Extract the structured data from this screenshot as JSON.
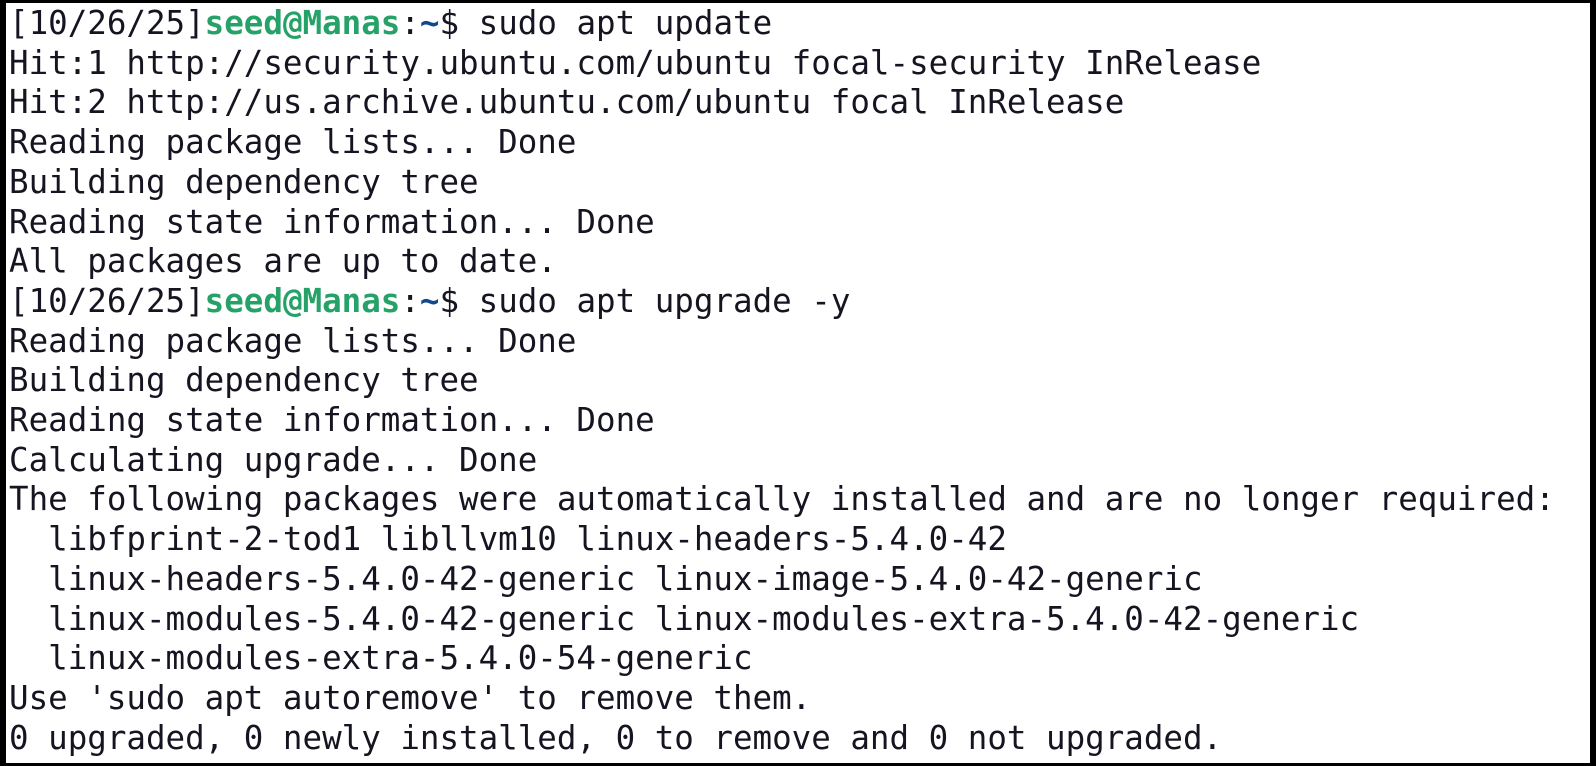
{
  "terminal": {
    "lines": [
      {
        "type": "prompt",
        "date": "[10/26/25]",
        "user": "seed@Manas",
        "sep": ":",
        "cwd": "~",
        "sym": "$ ",
        "cmd": "sudo apt update"
      },
      {
        "type": "output",
        "text": "Hit:1 http://security.ubuntu.com/ubuntu focal-security InRelease"
      },
      {
        "type": "output",
        "text": "Hit:2 http://us.archive.ubuntu.com/ubuntu focal InRelease"
      },
      {
        "type": "output",
        "text": "Reading package lists... Done"
      },
      {
        "type": "output",
        "text": "Building dependency tree"
      },
      {
        "type": "output",
        "text": "Reading state information... Done"
      },
      {
        "type": "output",
        "text": "All packages are up to date."
      },
      {
        "type": "prompt",
        "date": "[10/26/25]",
        "user": "seed@Manas",
        "sep": ":",
        "cwd": "~",
        "sym": "$ ",
        "cmd": "sudo apt upgrade -y"
      },
      {
        "type": "output",
        "text": "Reading package lists... Done"
      },
      {
        "type": "output",
        "text": "Building dependency tree"
      },
      {
        "type": "output",
        "text": "Reading state information... Done"
      },
      {
        "type": "output",
        "text": "Calculating upgrade... Done"
      },
      {
        "type": "output",
        "text": "The following packages were automatically installed and are no longer required:"
      },
      {
        "type": "output",
        "text": "  libfprint-2-tod1 libllvm10 linux-headers-5.4.0-42"
      },
      {
        "type": "output",
        "text": "  linux-headers-5.4.0-42-generic linux-image-5.4.0-42-generic"
      },
      {
        "type": "output",
        "text": "  linux-modules-5.4.0-42-generic linux-modules-extra-5.4.0-42-generic"
      },
      {
        "type": "output",
        "text": "  linux-modules-extra-5.4.0-54-generic"
      },
      {
        "type": "output",
        "text": "Use 'sudo apt autoremove' to remove them."
      },
      {
        "type": "output",
        "text": "0 upgraded, 0 newly installed, 0 to remove and 0 not upgraded."
      }
    ]
  }
}
